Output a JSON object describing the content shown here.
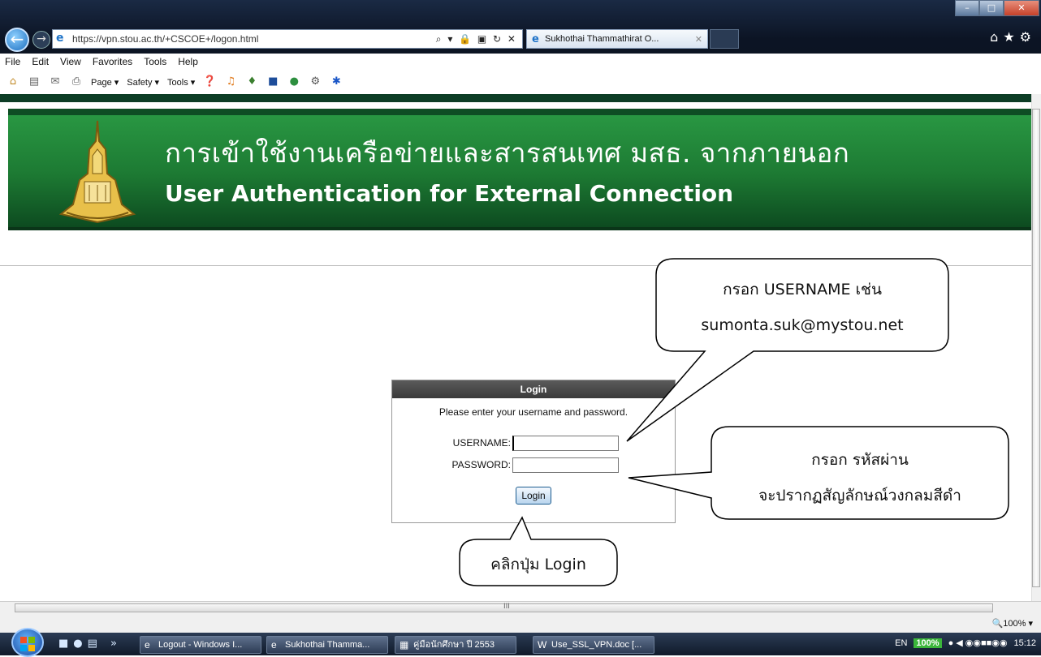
{
  "browser": {
    "url": "https://vpn.stou.ac.th/+CSCOE+/logon.html",
    "tab_title": "Sukhothai Thammathirat O...",
    "address_tools": "⌕ ▾ 🔒 ▣ ↻ ✕",
    "right_commands": "⌂★⚙"
  },
  "menu": [
    "File",
    "Edit",
    "View",
    "Favorites",
    "Tools",
    "Help"
  ],
  "command_bar": {
    "page": "Page ▾",
    "safety": "Safety ▾",
    "tools": "Tools ▾"
  },
  "banner": {
    "title_th": "การเข้าใช้งานเครือข่ายและสารสนเทศ มสธ. จากภายนอก",
    "title_en": "User Authentication for External Connection"
  },
  "login": {
    "header": "Login",
    "prompt": "Please enter your username and password.",
    "username_label": "USERNAME:",
    "password_label": "PASSWORD:",
    "username_value": "",
    "password_value": "",
    "button": "Login"
  },
  "callouts": {
    "username_line1": "กรอก USERNAME เช่น",
    "username_line2": "sumonta.suk@mystou.net",
    "password_line1": "กรอก รหัสผ่าน",
    "password_line2": "จะปรากฏสัญลักษณ์วงกลมสีดำ",
    "login_hint": "คลิกปุ่ม Login"
  },
  "status": {
    "zoom": "🔍100% ▾",
    "hscroll_grip": "III"
  },
  "taskbar": {
    "items": [
      "Logout - Windows I...",
      "Sukhothai Thamma...",
      "คู่มือนักศึกษา ปี 2553",
      "Use_SSL_VPN.doc [..."
    ],
    "lang": "EN",
    "battery": "100%",
    "clock": "15:12"
  }
}
